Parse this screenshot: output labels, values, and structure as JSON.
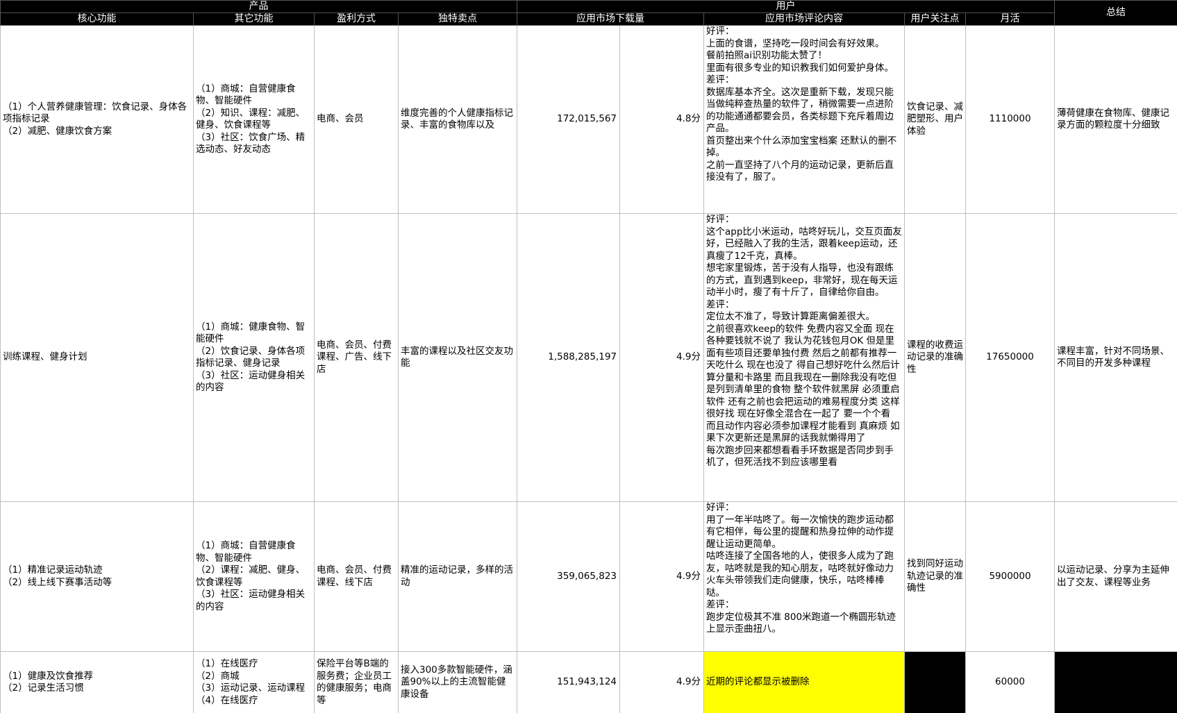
{
  "header": {
    "group_product": "产品",
    "group_user": "用户",
    "summary": "总结",
    "columns": [
      "核心功能",
      "其它功能",
      "盈利方式",
      "独特卖点",
      "应用市场下载量",
      "应用市场评论内容",
      "用户关注点",
      "月活"
    ]
  },
  "colors": {
    "header_bg": "#000000",
    "header_text": "#ffffff",
    "highlight": "#ffff00",
    "border": "#bfbfbf"
  },
  "rows": [
    {
      "core": "（1）个人营养健康管理：饮食记录、身体各项指标记录\n（2）减肥、健康饮食方案",
      "other": "（1）商城：自营健康食物、智能硬件\n（2）知识、课程：减肥、健身、饮食课程等\n（3）社区：饮食广场、精选动态、好友动态",
      "profit": "电商、会员",
      "usp": "维度完善的个人健康指标记录、丰富的食物库以及",
      "downloads": "172,015,567",
      "rating": "4.8分",
      "reviews": "好评：\n上面的食谱，坚持吃一段时间会有好效果。\n餐前拍照ai识别功能太赞了！\n里面有很多专业的知识教我们如何爱护身体。\n差评：\n数据库基本齐全。这次是重新下载，发现只能当做纯粹查热量的软件了，稍微需要一点进阶的功能通通都要会员，各类标题下充斥着周边产品。\n首页整出来个什么添加宝宝档案 还默认的删不掉。\n之前一直坚持了八个月的运动记录，更新后直接没有了，服了。",
      "focus": "饮食记录、减肥塑形、用户体验",
      "mau": "1110000",
      "summary": "薄荷健康在食物库、健康记录方面的颗粒度十分细致"
    },
    {
      "core": "训练课程、健身计划",
      "other": "（1）商城：健康食物、智能硬件\n（2）饮食记录、身体各项指标记录、健身记录\n（3）社区：运动健身相关的内容",
      "profit": "电商、会员、付费课程、广告、线下店",
      "usp": "丰富的课程以及社区交友功能",
      "downloads": "1,588,285,197",
      "rating": "4.9分",
      "reviews": "好评：\n这个app比小米运动，咕咚好玩儿，交互页面友好，已经融入了我的生活，跟着keep运动，还真瘦了12千克，真棒。\n想宅家里锻炼，苦于没有人指导，也没有跟练的方式，直到遇到keep，非常好，现在每天运动半小时，瘦了有十斤了，自律给你自由。\n差评：\n定位太不准了，导致计算距离偏差很大。\n之前很喜欢keep的软件 免费内容又全面 现在各种要钱就不说了 我认为花钱包月OK 但是里面有些项目还要单独付费 然后之前都有推荐一天吃什么 现在也没了 得自己想好吃什么然后计算分量和卡路里 而且我现在一删除我没有吃但是列到清单里的食物 整个软件就黑屏 必须重启软件 还有之前也会把运动的难易程度分类 这样很好找 现在好像全混合在一起了 要一个个看 而且动作内容必须参加课程才能看到 真麻烦 如果下次更新还是黑屏的话我就懒得用了\n每次跑步回来都想看看手环数据是否同步到手机了，但死活找不到应该哪里看",
      "focus": "课程的收费运动记录的准确性",
      "mau": "17650000",
      "summary": "课程丰富，针对不同场景、不同目的开发多种课程"
    },
    {
      "core": "（1）精准记录运动轨迹\n（2）线上线下赛事活动等",
      "other": "（1）商城：自营健康食物、智能硬件\n（2）课程：减肥、健身、饮食课程等\n（3）社区：运动健身相关的内容",
      "profit": "电商、会员、付费课程、线下店",
      "usp": "精准的运动记录，多样的活动",
      "downloads": "359,065,823",
      "rating": "4.9分",
      "reviews": "好评：\n用了一年半咕咚了。每一次愉快的跑步运动都有它相伴，每公里的提醒和热身拉伸的动作提醒让运动更简单。\n咕咚连接了全国各地的人，使很多人成为了跑友，咕咚就是我的知心朋友，咕咚就好像动力火车头带领我们走向健康，快乐，咕咚棒棒哒。\n差评：\n跑步定位极其不准 800米跑道一个椭圆形轨迹上显示歪曲扭八。",
      "focus": "找到同好运动轨迹记录的准确性",
      "mau": "5900000",
      "summary": "以运动记录、分享为主延伸出了交友、课程等业务"
    },
    {
      "core": "（1）健康及饮食推荐\n（2）记录生活习惯",
      "other": "（1）在线医疗\n（2）商城\n（3）运动记录、运动课程\n（4）在线医疗",
      "profit": "保险平台等B端的服务费；企业员工的健康服务；电商等",
      "usp": "接入300多款智能硬件，涵盖90%以上的主流智能健康设备",
      "downloads": "151,943,124",
      "rating": "4.9分",
      "reviews": "近期的评论都显示被删除",
      "focus": "",
      "mau": "60000",
      "summary": ""
    }
  ]
}
